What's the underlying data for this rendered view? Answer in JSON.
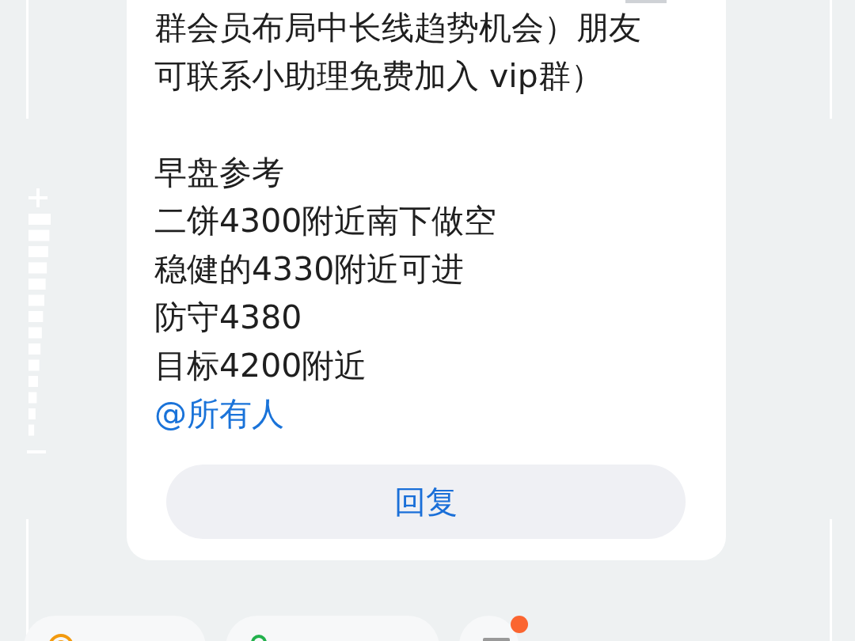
{
  "message": {
    "paragraphs": [
      [
        "群会员布局中长线趋势机会）朋友",
        "可联系小助理免费加入 vip群）"
      ],
      [
        "早盘参考",
        "二饼4300附近南下做空",
        "稳健的4330附近可进",
        "防守4380",
        "目标4200附近"
      ]
    ],
    "mention": "@所有人"
  },
  "reply_button": {
    "label": "回复"
  },
  "chips": [
    {
      "kind": "sign"
    },
    {
      "kind": "app"
    },
    {
      "kind": "more",
      "badge": true
    }
  ]
}
